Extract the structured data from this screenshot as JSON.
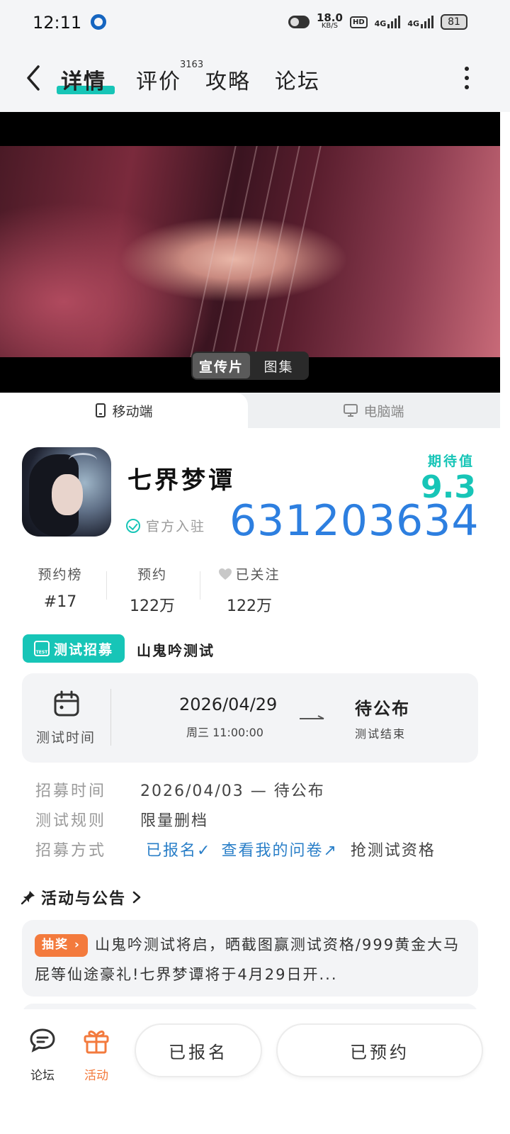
{
  "status_bar": {
    "time": "12:11",
    "net_speed": "18.0",
    "net_unit": "KB/S",
    "hd": "HD",
    "sim1": "4G",
    "sim2": "4G",
    "battery": "81"
  },
  "header": {
    "tabs": [
      {
        "label": "详情",
        "active": true
      },
      {
        "label": "评价",
        "badge": "3163"
      },
      {
        "label": "攻略"
      },
      {
        "label": "论坛"
      }
    ],
    "back_icon": "chevron-left-icon",
    "more_icon": "more-vertical-icon"
  },
  "video": {
    "switch": [
      {
        "label": "宣传片",
        "active": true
      },
      {
        "label": "图集"
      }
    ]
  },
  "platform": {
    "mobile": "移动端",
    "pc": "电脑端"
  },
  "game": {
    "title": "七界梦谭",
    "official": "官方入驻",
    "watermark": "631203634",
    "expect_label": "期待值",
    "expect_value": "9.3"
  },
  "stats": [
    {
      "label": "预约榜",
      "value": "#17"
    },
    {
      "label": "预约",
      "value": "122万"
    },
    {
      "label": "已关注",
      "value": "122万"
    }
  ],
  "recruit": {
    "badge": "测试招募",
    "badge_icon_text": "TEST",
    "name": "山鬼吟测试",
    "test_time_label": "测试时间",
    "start_date": "2026/04/29",
    "start_detail": "周三  11:00:00",
    "end_status": "待公布",
    "end_label": "测试结束",
    "rows": {
      "recruit_time_label": "招募时间",
      "recruit_time_value": "2026/04/03 — 待公布",
      "rule_label": "测试规则",
      "rule_value": "限量删档",
      "method_label": "招募方式",
      "signed": "已报名✓",
      "questionnaire": "查看我的问卷↗",
      "grab": "抢测试资格"
    }
  },
  "activity": {
    "title": "活动与公告",
    "tag": "抽奖",
    "text": "山鬼吟测试将启，晒截图赢测试资格/999黄金大马屁等仙途豪礼!七界梦谭将于4月29日开..."
  },
  "bottom_bar": {
    "forum": "论坛",
    "activity": "活动",
    "signed_button": "已报名",
    "reserved_button": "已预约"
  },
  "colors": {
    "accent": "#17c5b7",
    "link": "#2a7fc8",
    "orange": "#f37a3d",
    "watermark": "#2d7fe0"
  }
}
